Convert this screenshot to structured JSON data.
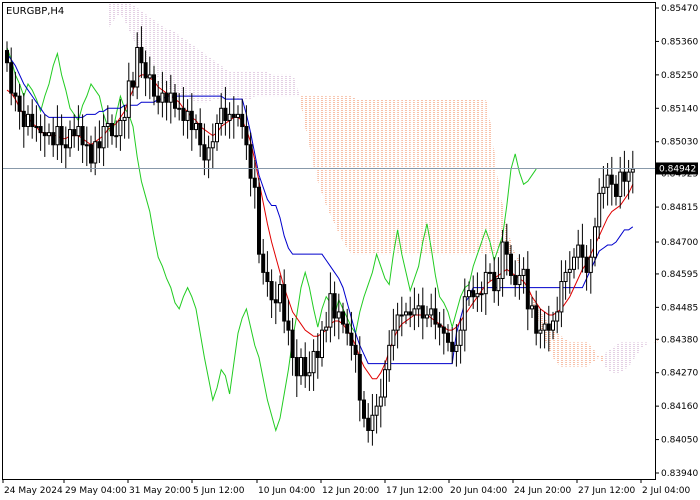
{
  "chart_data": {
    "type": "candlestick",
    "symbol": "EURGBP,H4",
    "current_price": 0.84942,
    "y_ticks": [
      "0.85470",
      "0.85360",
      "0.85250",
      "0.85140",
      "0.85030",
      "0.84925",
      "0.84815",
      "0.84700",
      "0.84595",
      "0.84485",
      "0.84380",
      "0.84270",
      "0.84160",
      "0.84050",
      "0.83940"
    ],
    "y_tick_values": [
      0.8547,
      0.8536,
      0.8525,
      0.8514,
      0.8503,
      0.84925,
      0.84815,
      0.847,
      0.84595,
      0.84485,
      0.8438,
      0.8427,
      0.8416,
      0.8405,
      0.8394
    ],
    "x_ticks": [
      "24 May 2024",
      "29 May 04:00",
      "31 May 20:00",
      "5 Jun 12:00",
      "10 Jun 04:00",
      "12 Jun 20:00",
      "17 Jun 12:00",
      "20 Jun 04:00",
      "24 Jun 20:00",
      "27 Jun 12:00",
      "2 Jul 04:00"
    ],
    "bars_per_day": 6,
    "colors": {
      "candles": "#000000",
      "tenkan": "#e00000",
      "kijun": "#0000cc",
      "chikou": "#22cc22",
      "span_a": "#f08050",
      "span_b": "#c8a0c8",
      "price_line": "#8899aa",
      "price_tag_bg": "#000000"
    },
    "series": [
      {
        "name": "candles",
        "closes": [
          0.8529,
          0.8519,
          0.8518,
          0.8513,
          0.8508,
          0.8512,
          0.8508,
          0.8508,
          0.8506,
          0.8505,
          0.8506,
          0.8502,
          0.8508,
          0.8502,
          0.8501,
          0.8507,
          0.8505,
          0.8508,
          0.8502,
          0.8502,
          0.8496,
          0.8503,
          0.8501,
          0.8508,
          0.8509,
          0.8505,
          0.8505,
          0.851,
          0.8511,
          0.8523,
          0.8521,
          0.8534,
          0.8529,
          0.8524,
          0.8525,
          0.8518,
          0.8516,
          0.8519,
          0.8516,
          0.8519,
          0.8514,
          0.8514,
          0.851,
          0.8513,
          0.8507,
          0.8509,
          0.8502,
          0.8497,
          0.8501,
          0.8503,
          0.8509,
          0.8514,
          0.851,
          0.8512,
          0.8511,
          0.8512,
          0.8508,
          0.8502,
          0.8491,
          0.8488,
          0.8466,
          0.846,
          0.8457,
          0.8451,
          0.845,
          0.8456,
          0.8444,
          0.8441,
          0.8432,
          0.8426,
          0.8432,
          0.8426,
          0.8427,
          0.8434,
          0.8432,
          0.8441,
          0.8442,
          0.8453,
          0.8445,
          0.8447,
          0.8443,
          0.844,
          0.8436,
          0.8433,
          0.8418,
          0.8412,
          0.8408,
          0.8413,
          0.8416,
          0.8419,
          0.8428,
          0.8436,
          0.8441,
          0.8446,
          0.8446,
          0.8447,
          0.8446,
          0.8448,
          0.8449,
          0.8445,
          0.8446,
          0.8448,
          0.8443,
          0.8442,
          0.844,
          0.8437,
          0.8434,
          0.8436,
          0.8441,
          0.8452,
          0.8454,
          0.8452,
          0.8453,
          0.8453,
          0.846,
          0.846,
          0.8454,
          0.8458,
          0.847,
          0.8466,
          0.8459,
          0.8456,
          0.8459,
          0.8461,
          0.8448,
          0.8449,
          0.844,
          0.8441,
          0.8443,
          0.8441,
          0.8444,
          0.8447,
          0.8457,
          0.846,
          0.8461,
          0.8465,
          0.8469,
          0.8465,
          0.846,
          0.8465,
          0.8475,
          0.8486,
          0.8488,
          0.8492,
          0.8489,
          0.8485,
          0.8493,
          0.849,
          0.8493,
          0.8494
        ]
      },
      {
        "name": "tenkan",
        "values": [
          0.852,
          0.8519,
          0.8517,
          0.8514,
          0.8512,
          0.8511,
          0.8509,
          0.8508,
          0.8506,
          0.8506,
          0.8505,
          0.8505,
          0.8505,
          0.8504,
          0.8504,
          0.8505,
          0.8505,
          0.8505,
          0.8504,
          0.8503,
          0.8502,
          0.8503,
          0.8504,
          0.8505,
          0.8507,
          0.8508,
          0.8509,
          0.8511,
          0.8513,
          0.8517,
          0.852,
          0.8524,
          0.8525,
          0.8525,
          0.8524,
          0.8523,
          0.8521,
          0.852,
          0.8519,
          0.8518,
          0.8517,
          0.8516,
          0.8514,
          0.8513,
          0.8511,
          0.851,
          0.8508,
          0.8507,
          0.8506,
          0.8505,
          0.8506,
          0.8508,
          0.8509,
          0.851,
          0.8511,
          0.8511,
          0.851,
          0.8507,
          0.8503,
          0.8497,
          0.849,
          0.8483,
          0.8476,
          0.847,
          0.8465,
          0.846,
          0.8455,
          0.8451,
          0.8447,
          0.8445,
          0.8443,
          0.8441,
          0.844,
          0.8439,
          0.8439,
          0.844,
          0.8441,
          0.8443,
          0.8444,
          0.8444,
          0.8443,
          0.8441,
          0.8439,
          0.8436,
          0.8432,
          0.8429,
          0.8427,
          0.8425,
          0.8425,
          0.8427,
          0.843,
          0.8434,
          0.8438,
          0.8441,
          0.8443,
          0.8444,
          0.8445,
          0.8446,
          0.8446,
          0.8446,
          0.8446,
          0.8445,
          0.8444,
          0.8443,
          0.8442,
          0.8441,
          0.8441,
          0.8442,
          0.8444,
          0.8446,
          0.8448,
          0.845,
          0.8452,
          0.8454,
          0.8456,
          0.8457,
          0.8458,
          0.8459,
          0.846,
          0.8461,
          0.846,
          0.8459,
          0.8458,
          0.8457,
          0.8455,
          0.8452,
          0.845,
          0.8448,
          0.8447,
          0.8446,
          0.8446,
          0.8447,
          0.8448,
          0.845,
          0.8452,
          0.8455,
          0.8458,
          0.8461,
          0.8463,
          0.8466,
          0.8469,
          0.8472,
          0.8475,
          0.8478,
          0.848,
          0.8481,
          0.8482,
          0.8484,
          0.8486,
          0.8489
        ]
      },
      {
        "name": "kijun",
        "values": [
          0.8532,
          0.853,
          0.8528,
          0.8525,
          0.8522,
          0.852,
          0.8518,
          0.8516,
          0.8514,
          0.8512,
          0.8511,
          0.8511,
          0.8511,
          0.8511,
          0.8511,
          0.8511,
          0.8511,
          0.8511,
          0.8511,
          0.8512,
          0.8512,
          0.8512,
          0.8513,
          0.8513,
          0.8514,
          0.8514,
          0.8514,
          0.8514,
          0.8515,
          0.8515,
          0.8515,
          0.8515,
          0.8516,
          0.8516,
          0.8516,
          0.8516,
          0.8517,
          0.8517,
          0.8518,
          0.8518,
          0.8518,
          0.8518,
          0.8518,
          0.8518,
          0.8518,
          0.8518,
          0.8518,
          0.8518,
          0.8518,
          0.8518,
          0.8518,
          0.8518,
          0.8517,
          0.8517,
          0.8517,
          0.8517,
          0.8517,
          0.8512,
          0.8506,
          0.8499,
          0.8492,
          0.8488,
          0.8484,
          0.8482,
          0.8482,
          0.8478,
          0.8472,
          0.8468,
          0.8466,
          0.8466,
          0.8466,
          0.8466,
          0.8466,
          0.8466,
          0.8466,
          0.8466,
          0.8464,
          0.8462,
          0.846,
          0.8458,
          0.8455,
          0.845,
          0.8445,
          0.844,
          0.8436,
          0.8433,
          0.843,
          0.843,
          0.843,
          0.843,
          0.843,
          0.843,
          0.843,
          0.843,
          0.843,
          0.843,
          0.843,
          0.843,
          0.843,
          0.843,
          0.843,
          0.843,
          0.843,
          0.843,
          0.843,
          0.843,
          0.843,
          0.844,
          0.8445,
          0.845,
          0.8452,
          0.8455,
          0.8455,
          0.8455,
          0.8455,
          0.8455,
          0.8455,
          0.8455,
          0.8455,
          0.8455,
          0.8455,
          0.8455,
          0.8455,
          0.8455,
          0.8455,
          0.8455,
          0.8455,
          0.8455,
          0.8455,
          0.8455,
          0.8455,
          0.8455,
          0.8455,
          0.8455,
          0.8455,
          0.8455,
          0.8455,
          0.8455,
          0.8458,
          0.8461,
          0.8464,
          0.8467,
          0.8468,
          0.8469,
          0.8469,
          0.847,
          0.8472,
          0.8474,
          0.8474,
          0.8475
        ]
      },
      {
        "name": "chikou",
        "values": [
          0.8534,
          0.853,
          0.8525,
          0.8522,
          0.8518,
          0.8522,
          0.852,
          0.8517,
          0.8513,
          0.8518,
          0.8522,
          0.8528,
          0.8532,
          0.8525,
          0.852,
          0.8514,
          0.8512,
          0.851,
          0.8515,
          0.8518,
          0.8522,
          0.852,
          0.8518,
          0.8512,
          0.8508,
          0.8505,
          0.8512,
          0.8518,
          0.8514,
          0.8512,
          0.8508,
          0.8498,
          0.849,
          0.8485,
          0.848,
          0.8472,
          0.8465,
          0.8462,
          0.8458,
          0.8455,
          0.845,
          0.8448,
          0.8452,
          0.8455,
          0.8452,
          0.8448,
          0.844,
          0.8432,
          0.8425,
          0.8418,
          0.8422,
          0.8428,
          0.8426,
          0.842,
          0.843,
          0.844,
          0.8445,
          0.8448,
          0.8442,
          0.8436,
          0.8432,
          0.8425,
          0.8418,
          0.8413,
          0.8408,
          0.8412,
          0.842,
          0.8428,
          0.8438,
          0.8446,
          0.8455,
          0.846,
          0.8455,
          0.8448,
          0.8442,
          0.8448,
          0.8452,
          0.845,
          0.8446,
          0.8451,
          0.8448,
          0.8445,
          0.8442,
          0.844,
          0.8447,
          0.8452,
          0.8456,
          0.846,
          0.8466,
          0.8462,
          0.8458,
          0.8456,
          0.8466,
          0.8474,
          0.8466,
          0.846,
          0.8454,
          0.8458,
          0.8462,
          0.847,
          0.8476,
          0.8468,
          0.8459,
          0.8452,
          0.845,
          0.8447,
          0.8442,
          0.8447,
          0.8452,
          0.8455,
          0.8456,
          0.8462,
          0.8466,
          0.847,
          0.8474,
          0.847,
          0.8464,
          0.8468,
          0.8472,
          0.8482,
          0.8494,
          0.8499,
          0.8493,
          0.8489,
          0.849,
          0.8492,
          0.8494
        ]
      },
      {
        "name": "span_a",
        "values": [
          0.854,
          0.8542,
          0.8544,
          0.8545,
          0.8543,
          0.854,
          0.8537,
          0.8534,
          0.8532,
          0.853,
          0.8528,
          0.8526,
          0.8524,
          0.8522,
          0.8521,
          0.852,
          0.8519,
          0.8518,
          0.8518,
          0.8517,
          0.8517,
          0.8516,
          0.8516,
          0.8516,
          0.8516,
          0.8517,
          0.8517,
          0.8517,
          0.8518,
          0.8518,
          0.8517,
          0.8517,
          0.8517,
          0.8517,
          0.8517,
          0.8518,
          0.8518,
          0.8518,
          0.8518,
          0.8518,
          0.8518,
          0.8518,
          0.8518,
          0.8518,
          0.8518,
          0.8518,
          0.8518,
          0.8518,
          0.8518,
          0.8518,
          0.8518,
          0.8518,
          0.8518,
          0.8518,
          0.8518,
          0.8518,
          0.8518,
          0.8518,
          0.8518,
          0.8517,
          0.8517,
          0.8517,
          0.8517,
          0.8517,
          0.8517,
          0.8517,
          0.8517,
          0.8517,
          0.8517,
          0.8517,
          0.8517,
          0.8517,
          0.8517,
          0.8517,
          0.8517,
          0.8517,
          0.8517,
          0.8517,
          0.8517,
          0.8517,
          0.8517,
          0.8517,
          0.8517,
          0.8517,
          0.8517,
          0.8517,
          0.8517,
          0.8517,
          0.8517,
          0.8517,
          0.8517,
          0.851,
          0.85,
          0.849,
          0.8482,
          0.8475,
          0.847,
          0.8466,
          0.8462,
          0.8458,
          0.8455,
          0.8452,
          0.8449,
          0.8447,
          0.8445,
          0.8443,
          0.8441,
          0.844,
          0.8439,
          0.8438,
          0.8437,
          0.8437,
          0.8437,
          0.8437,
          0.8437,
          0.8436,
          0.8434,
          0.8432,
          0.843,
          0.8428,
          0.8427,
          0.8427,
          0.8427,
          0.8428,
          0.8429,
          0.8431,
          0.8433,
          0.8435,
          0.8436,
          0.8437,
          0.8437,
          0.8437,
          0.8436,
          0.8435,
          0.8435,
          0.8436,
          0.8438,
          0.844,
          0.8442,
          0.8444,
          0.8446,
          0.8448,
          0.8448,
          0.8447,
          0.8447,
          0.8446,
          0.8445,
          0.8445
        ]
      },
      {
        "name": "span_b",
        "values": [
          0.8549,
          0.8549,
          0.8549,
          0.8549,
          0.8549,
          0.8549,
          0.8548,
          0.8547,
          0.8546,
          0.8545,
          0.8544,
          0.8543,
          0.8542,
          0.8541,
          0.854,
          0.854,
          0.8539,
          0.8538,
          0.8537,
          0.8536,
          0.8535,
          0.8534,
          0.8533,
          0.8532,
          0.8531,
          0.853,
          0.8529,
          0.8528,
          0.8527,
          0.8526,
          0.8526,
          0.8526,
          0.8526,
          0.8526,
          0.8526,
          0.8526,
          0.8526,
          0.8526,
          0.8526,
          0.8525,
          0.8525,
          0.8525,
          0.8525,
          0.8525,
          0.8525,
          0.8522,
          0.8515,
          0.8508,
          0.8502,
          0.8495,
          0.849,
          0.8486,
          0.8482,
          0.8479,
          0.8476,
          0.8473,
          0.847,
          0.8468,
          0.8466,
          0.8466,
          0.8466,
          0.8466,
          0.8466,
          0.8466,
          0.8466,
          0.8466,
          0.8466,
          0.8466,
          0.8466,
          0.8466,
          0.8466,
          0.8466,
          0.8466,
          0.8466,
          0.8466,
          0.8466,
          0.8466,
          0.8466,
          0.8466,
          0.8466,
          0.8466,
          0.8466,
          0.8466,
          0.8466,
          0.8466,
          0.8466,
          0.8466,
          0.8466,
          0.8466,
          0.8466,
          0.8466,
          0.8466,
          0.8466,
          0.8466,
          0.8466,
          0.8466,
          0.8466,
          0.8466,
          0.8464,
          0.846,
          0.8455,
          0.845,
          0.8446,
          0.8442,
          0.8438,
          0.8435,
          0.8432,
          0.843,
          0.8429,
          0.8429,
          0.8429,
          0.8429,
          0.8429,
          0.8429,
          0.8429,
          0.843,
          0.8431,
          0.8432,
          0.8433,
          0.8434,
          0.8435,
          0.8436,
          0.8437,
          0.8437,
          0.8437,
          0.8437,
          0.8437,
          0.8437,
          0.8437,
          0.8437,
          0.8437,
          0.8438,
          0.844,
          0.8442,
          0.8444,
          0.8446,
          0.8448,
          0.845,
          0.8452,
          0.8454,
          0.8455,
          0.8455,
          0.8455,
          0.8455,
          0.8455,
          0.8455,
          0.8455,
          0.8455,
          0.8455,
          0.8455
        ]
      }
    ],
    "ylim": [
      0.8394,
      0.8547
    ],
    "grid": false
  }
}
